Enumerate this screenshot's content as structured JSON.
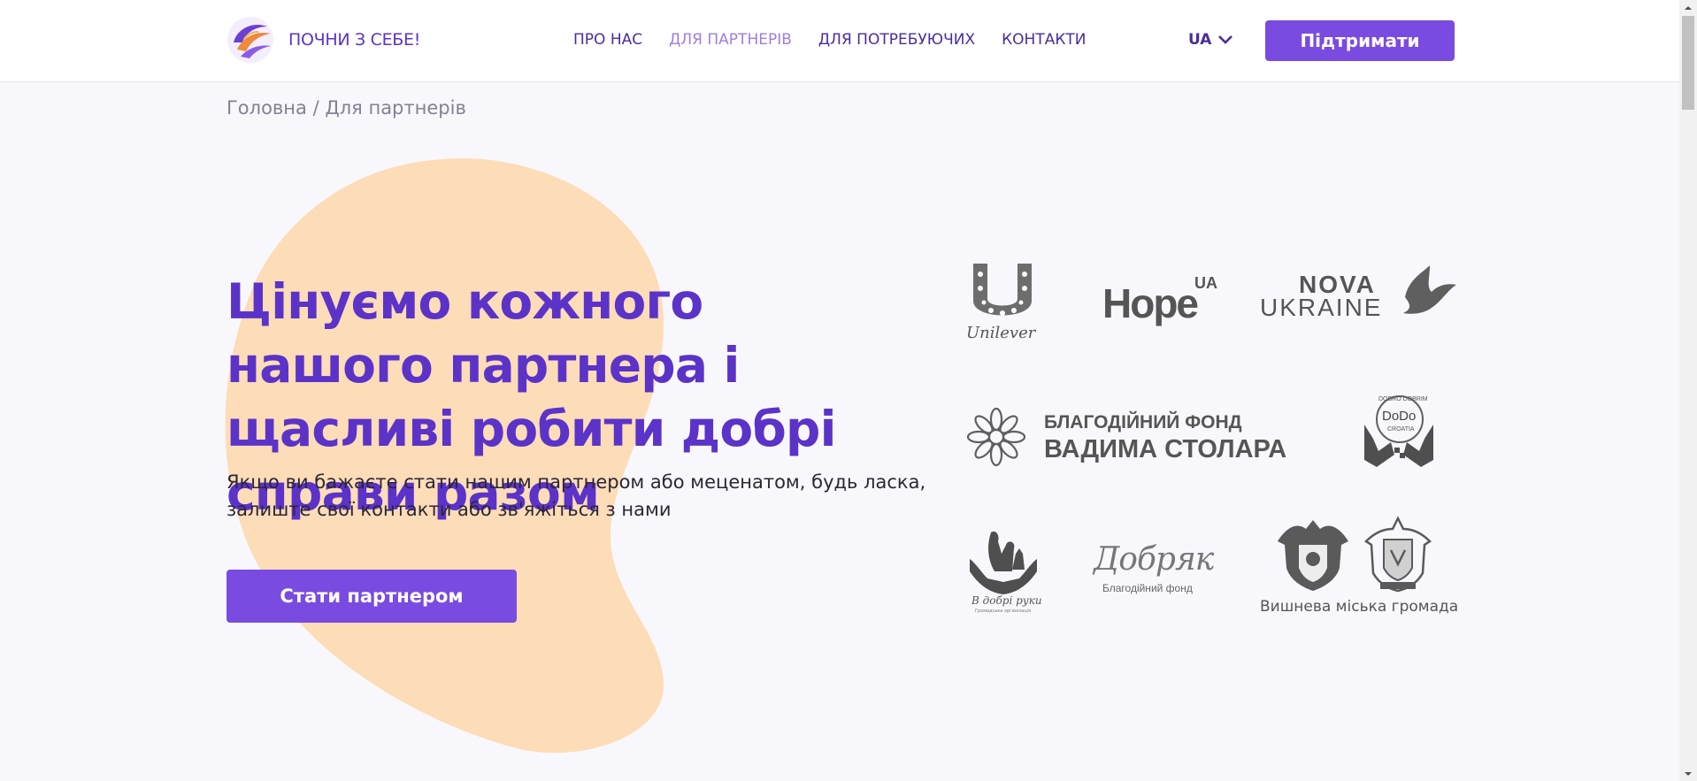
{
  "header": {
    "logo_text": "ПОЧНИ З СЕБЕ!",
    "nav": [
      {
        "label": "ПРО НАС",
        "active": false
      },
      {
        "label": "ДЛЯ ПАРТНЕРІВ",
        "active": true
      },
      {
        "label": "ДЛЯ ПОТРЕБУЮЧИХ",
        "active": false
      },
      {
        "label": "КОНТАКТИ",
        "active": false
      }
    ],
    "language": "UA",
    "support_label": "Підтримати"
  },
  "breadcrumb": "Головна / Для партнерів",
  "hero": {
    "title": "Цінуємо кожного нашого партнера і щасливі робити добрі справи разом",
    "subtitle": "Якщо ви бажаєте стати нашим партнером або меценатом, будь ласка, залиште свої контакти або зв'яжіться з нами",
    "cta_label": "Стати партнером"
  },
  "partners": {
    "unilever": "Unilever",
    "hope_main": "Hope",
    "hope_sup": "UA",
    "nova_1": "NOVA",
    "nova_2": "UKRAINE",
    "stolar_1": "БЛАГОДІЙНИЙ ФОНД",
    "stolar_2": "ВАДИМА СТОЛАРА",
    "dodo_top": "DOBRO DOBRIM",
    "dodo_mid": "DoDo",
    "dodo_bot": "CROATIA",
    "vdobri_1": "В добрі руки",
    "vdobri_2": "Громадська організація",
    "dobryak_1": "Добряк",
    "dobryak_2": "Благодійний фонд",
    "vyshneva": "Вишнева міська громада"
  },
  "colors": {
    "brand": "#7a4be0",
    "heading": "#5b33c8",
    "blob": "#fddcb8"
  }
}
